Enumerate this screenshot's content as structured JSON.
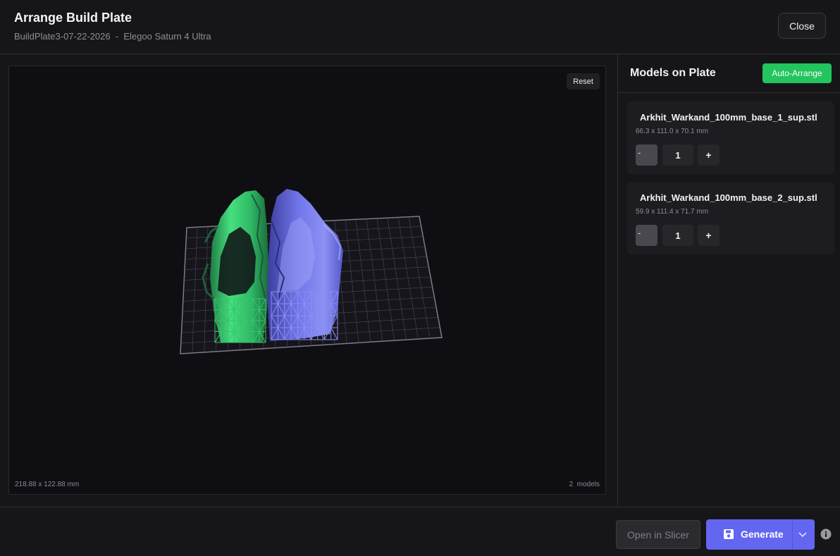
{
  "header": {
    "title": "Arrange Build Plate",
    "subtitle": "BuildPlate3-07-22-2026  -  Elegoo Saturn 4 Ultra",
    "close_label": "Close"
  },
  "viewport": {
    "reset_label": "Reset",
    "plate_dimensions": "218.88 x 122.88 mm",
    "model_count": "2  models"
  },
  "sidebar": {
    "title": "Models on Plate",
    "auto_arrange_label": "Auto-Arrange",
    "models": [
      {
        "name": "Arkhit_Warkand_100mm_base_1_sup.stl",
        "dimensions": "66.3 x 111.0 x 70.1 mm",
        "quantity": "1",
        "color": "#3fd978"
      },
      {
        "name": "Arkhit_Warkand_100mm_base_2_sup.stl",
        "dimensions": "59.9 x 111.4 x 71.7 mm",
        "quantity": "1",
        "color": "#7479f0"
      }
    ],
    "minus_label": "-",
    "plus_label": "+"
  },
  "footer": {
    "open_slicer_label": "Open in Slicer",
    "generate_label": "Generate"
  },
  "icons": {
    "generate": "floppy-disk-icon",
    "dropdown": "chevron-down-icon",
    "info": "info-icon"
  },
  "colors": {
    "accent": "#6366f1",
    "success": "#22c55e",
    "background": "#161619"
  }
}
